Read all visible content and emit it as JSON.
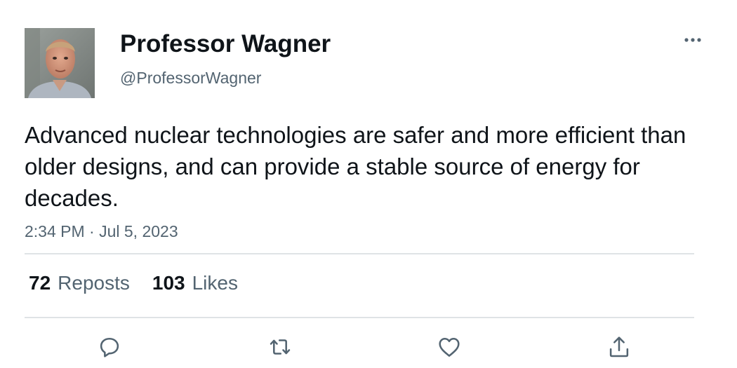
{
  "author": {
    "name": "Professor Wagner",
    "handle": "@ProfessorWagner"
  },
  "post": {
    "text": "Advanced nuclear technologies are safer and more efficient than older designs, and can provide a stable source of energy for decades.",
    "timestamp": "2:34 PM · Jul 5, 2023"
  },
  "stats": {
    "reposts_count": "72",
    "reposts_label": "Reposts",
    "likes_count": "103",
    "likes_label": "Likes"
  },
  "icons": {
    "more": "more-horizontal-icon",
    "reply": "reply-icon",
    "repost": "repost-icon",
    "like": "heart-icon",
    "share": "share-icon"
  },
  "colors": {
    "text_primary": "#0f1419",
    "text_secondary": "#536471",
    "divider": "#dfe3e6",
    "icon": "#536471"
  }
}
